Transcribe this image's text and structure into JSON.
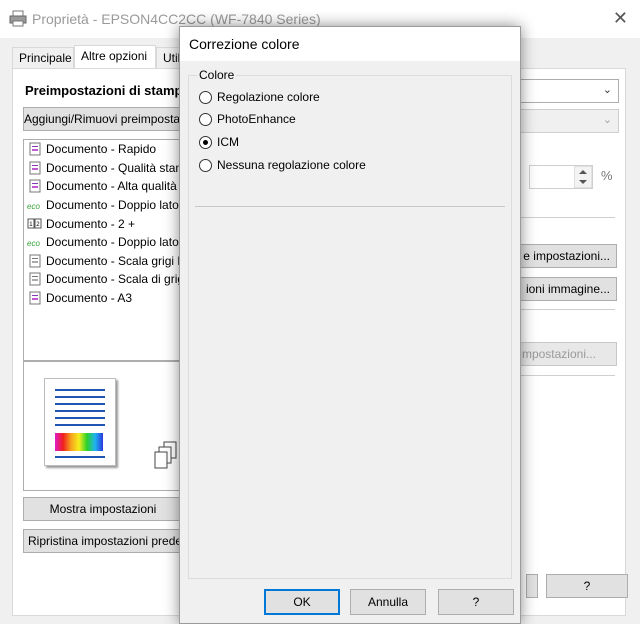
{
  "window": {
    "title": "Proprietà - EPSON4CC2CC (WF-7840 Series)",
    "close_glyph": "✕"
  },
  "tabs": [
    {
      "label": "Principale"
    },
    {
      "label": "Altre opzioni"
    },
    {
      "label": "Utili"
    }
  ],
  "presets": {
    "title": "Preimpostazioni di stampa",
    "add_remove_label": "Aggiungi/Rimuovi preimpostazioni",
    "items": [
      {
        "label": "Documento - Rapido",
        "icon": "document-icon"
      },
      {
        "label": "Documento - Qualità standard",
        "icon": "document-icon"
      },
      {
        "label": "Documento - Alta qualità",
        "icon": "document-icon"
      },
      {
        "label": "Documento - Doppio lato",
        "icon": "eco-icon"
      },
      {
        "label": "Documento - 2 +",
        "icon": "two-up-icon"
      },
      {
        "label": "Documento - Doppio lato",
        "icon": "eco-icon"
      },
      {
        "label": "Documento - Scala grigi Rapido",
        "icon": "grayscale-document-icon"
      },
      {
        "label": "Documento - Scala di grigi",
        "icon": "grayscale-document-icon"
      },
      {
        "label": "Documento - A3",
        "icon": "document-icon"
      }
    ],
    "show_settings_label": "Mostra impostazioni",
    "reset_label": "Ripristina impostazioni predefinite"
  },
  "right_panel": {
    "percent_unit": "%",
    "advanced_settings_label": "e impostazioni...",
    "image_options_label": "ioni immagine...",
    "disabled_settings_label": "mpostazioni...",
    "help_label": "?"
  },
  "dialog": {
    "title": "Correzione colore",
    "group_label": "Colore",
    "options": [
      {
        "label": "Regolazione colore",
        "checked": false
      },
      {
        "label": "PhotoEnhance",
        "checked": false
      },
      {
        "label": "ICM",
        "checked": true
      },
      {
        "label": "Nessuna regolazione colore",
        "checked": false
      }
    ],
    "ok_label": "OK",
    "cancel_label": "Annulla",
    "help_label": "?"
  },
  "colors": {
    "accent": "#0078d7",
    "title_text_inactive": "#9a9a9a",
    "preview_line": "#1f56b4"
  }
}
